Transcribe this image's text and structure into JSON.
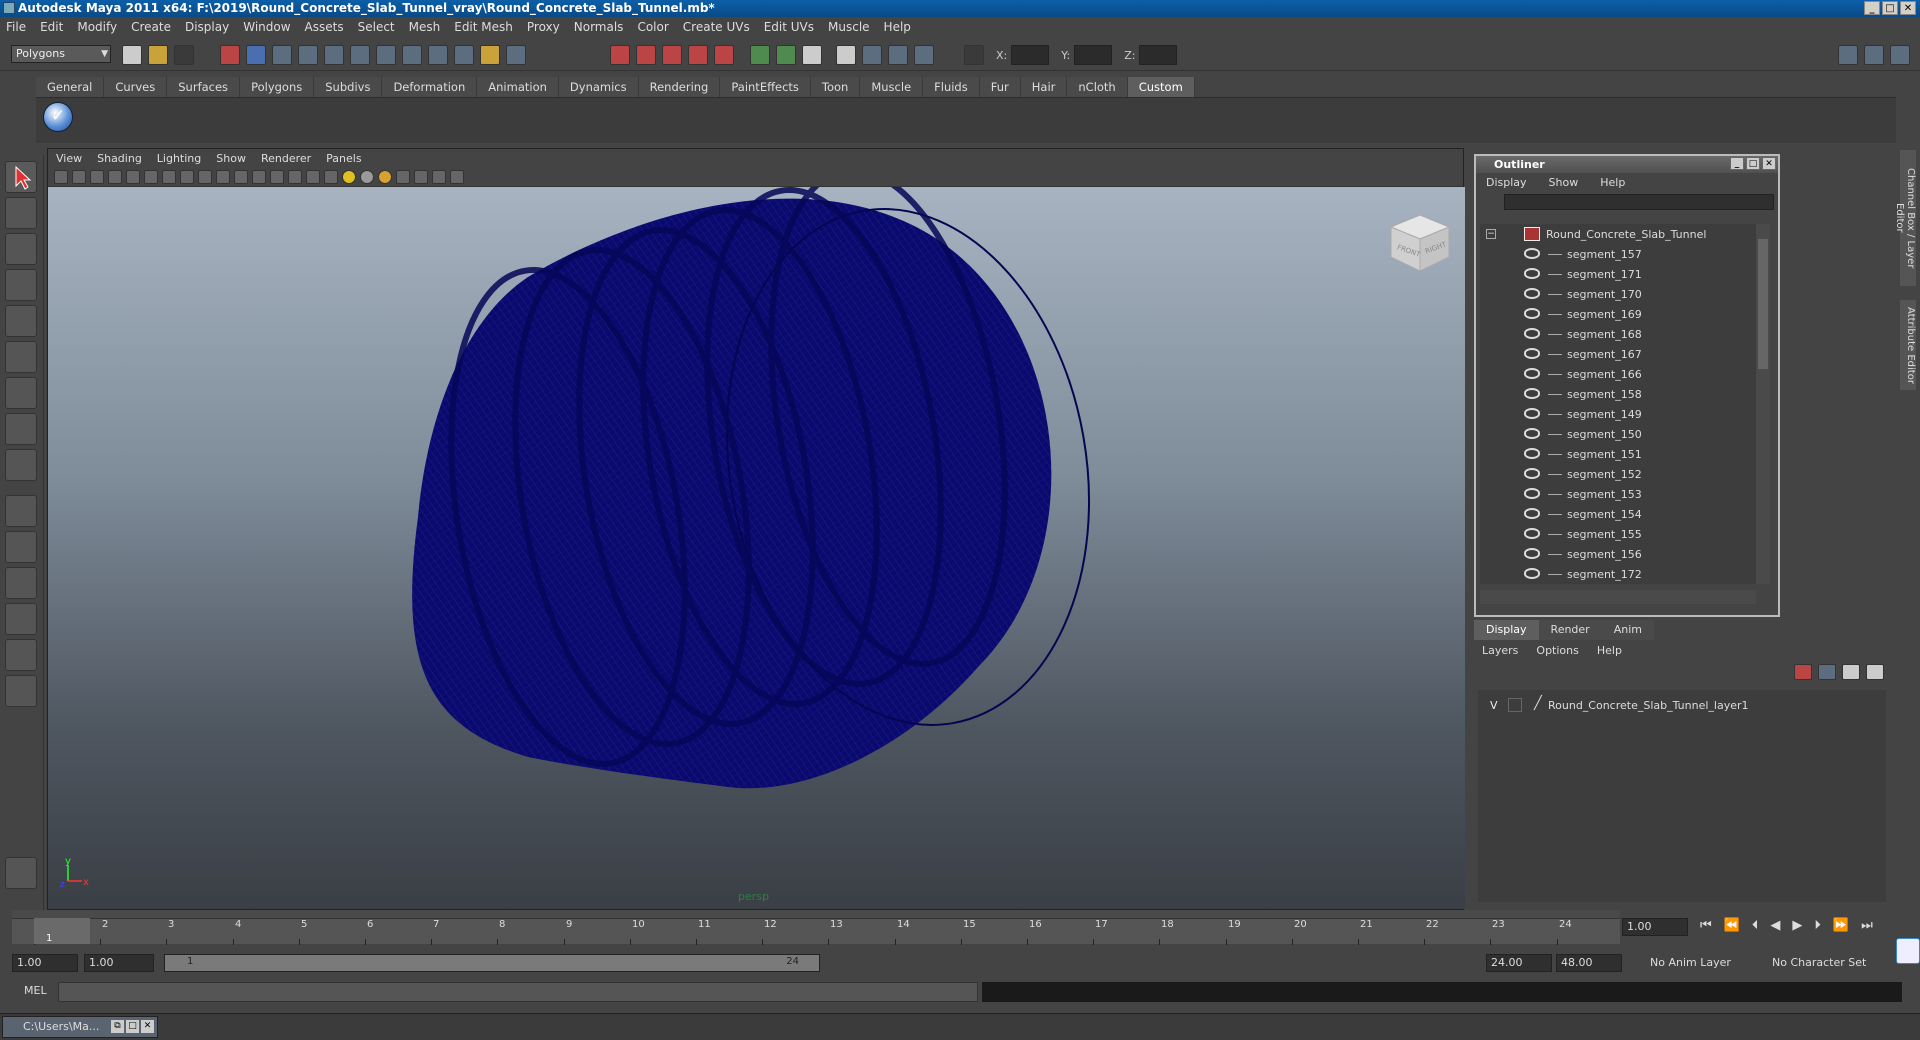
{
  "window": {
    "title": "Autodesk Maya 2011 x64: F:\\2019\\Round_Concrete_Slab_Tunnel_vray\\Round_Concrete_Slab_Tunnel.mb*"
  },
  "menubar": [
    "File",
    "Edit",
    "Modify",
    "Create",
    "Display",
    "Window",
    "Assets",
    "Select",
    "Mesh",
    "Edit Mesh",
    "Proxy",
    "Normals",
    "Color",
    "Create UVs",
    "Edit UVs",
    "Muscle",
    "Help"
  ],
  "status": {
    "mode": "Polygons",
    "x_label": "X:",
    "y_label": "Y:",
    "z_label": "Z:"
  },
  "shelf_tabs": [
    "General",
    "Curves",
    "Surfaces",
    "Polygons",
    "Subdivs",
    "Deformation",
    "Animation",
    "Dynamics",
    "Rendering",
    "PaintEffects",
    "Toon",
    "Muscle",
    "Fluids",
    "Fur",
    "Hair",
    "nCloth",
    "Custom"
  ],
  "shelf_active": "Custom",
  "viewport": {
    "menu": [
      "View",
      "Shading",
      "Lighting",
      "Show",
      "Renderer",
      "Panels"
    ],
    "camera_label": "persp",
    "viewcube": {
      "front": "FRONT",
      "right": "RIGHT"
    },
    "axis": {
      "x": "x",
      "y": "y",
      "z": "z"
    },
    "mesh_color": "#0a0a6e"
  },
  "outliner": {
    "title": "Outliner",
    "menu": [
      "Display",
      "Show",
      "Help"
    ],
    "root": "Round_Concrete_Slab_Tunnel",
    "items": [
      "segment_157",
      "segment_171",
      "segment_170",
      "segment_169",
      "segment_168",
      "segment_167",
      "segment_166",
      "segment_158",
      "segment_149",
      "segment_150",
      "segment_151",
      "segment_152",
      "segment_153",
      "segment_154",
      "segment_155",
      "segment_156",
      "segment_172"
    ]
  },
  "layer_editor": {
    "tabs": [
      "Display",
      "Render",
      "Anim"
    ],
    "active_tab": "Display",
    "menu": [
      "Layers",
      "Options",
      "Help"
    ],
    "layer": {
      "visible": "V",
      "name": "Round_Concrete_Slab_Tunnel_layer1"
    }
  },
  "side_tabs": [
    "Channel Box / Layer Editor",
    "Attribute Editor"
  ],
  "timeline": {
    "ticks": [
      "1",
      "2",
      "3",
      "4",
      "5",
      "6",
      "7",
      "8",
      "9",
      "10",
      "11",
      "12",
      "13",
      "14",
      "15",
      "16",
      "17",
      "18",
      "19",
      "20",
      "21",
      "22",
      "23",
      "24"
    ],
    "current_frame": "1",
    "current_field": "1.00"
  },
  "range": {
    "start": "1.00",
    "start2": "1.00",
    "slider_start": "1",
    "slider_end": "24",
    "end": "24.00",
    "end2": "48.00",
    "anim_layer": "No Anim Layer",
    "char_set": "No Character Set"
  },
  "cmd": {
    "label": "MEL"
  },
  "taskbar": {
    "item": "C:\\Users\\Ma..."
  }
}
